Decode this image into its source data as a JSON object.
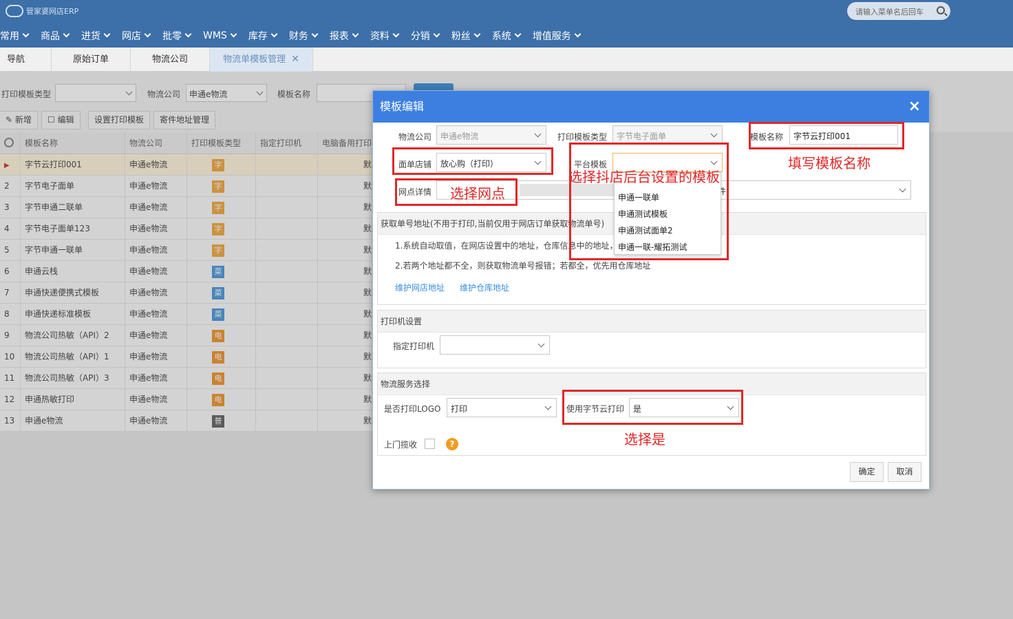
{
  "header": {
    "logo_text": "管家婆网店ERP",
    "search_placeholder": "请输入菜单名后回车"
  },
  "menu": [
    "常用",
    "商品",
    "进货",
    "网店",
    "批零",
    "WMS",
    "库存",
    "财务",
    "报表",
    "资料",
    "分销",
    "粉丝",
    "系统",
    "增值服务"
  ],
  "tabs": [
    {
      "label": "导航",
      "active": false
    },
    {
      "label": "原始订单",
      "active": false
    },
    {
      "label": "物流公司",
      "active": false
    },
    {
      "label": "物流单模板管理",
      "active": true
    }
  ],
  "filters": {
    "print_type_label": "打印模板类型",
    "print_type_value": "",
    "company_label": "物流公司",
    "company_value": "申通e物流",
    "name_label": "模板名称",
    "name_value": ""
  },
  "toolbar": {
    "add": "新增",
    "edit": "编辑",
    "set_print": "设置打印模板",
    "address": "寄件地址管理"
  },
  "grid": {
    "headers": [
      "模板名称",
      "物流公司",
      "打印模板类型",
      "指定打印机",
      "电脑备用打印"
    ],
    "rows": [
      {
        "no": "",
        "name": "字节云打印001",
        "company": "申通e物流",
        "badge": "字",
        "color": "#f0a030",
        "printer": "",
        "backup": "默"
      },
      {
        "no": "2",
        "name": "字节电子面单",
        "company": "申通e物流",
        "badge": "字",
        "color": "#f0a030",
        "printer": "",
        "backup": "默"
      },
      {
        "no": "3",
        "name": "字节申通二联单",
        "company": "申通e物流",
        "badge": "字",
        "color": "#f0a030",
        "printer": "",
        "backup": "默"
      },
      {
        "no": "4",
        "name": "字节电子面单123",
        "company": "申通e物流",
        "badge": "字",
        "color": "#f0a030",
        "printer": "",
        "backup": "默"
      },
      {
        "no": "5",
        "name": "字节申通一联单",
        "company": "申通e物流",
        "badge": "字",
        "color": "#f0a030",
        "printer": "",
        "backup": "默"
      },
      {
        "no": "6",
        "name": "申通云栈",
        "company": "申通e物流",
        "badge": "菜",
        "color": "#3a8ed8",
        "printer": "",
        "backup": "默"
      },
      {
        "no": "7",
        "name": "申通快递便携式模板",
        "company": "申通e物流",
        "badge": "菜",
        "color": "#3a8ed8",
        "printer": "",
        "backup": "默"
      },
      {
        "no": "8",
        "name": "申通快递标准模板",
        "company": "申通e物流",
        "badge": "菜",
        "color": "#3a8ed8",
        "printer": "",
        "backup": "默"
      },
      {
        "no": "9",
        "name": "物流公司热敏（API）2",
        "company": "申通e物流",
        "badge": "电",
        "color": "#ef8a1c",
        "printer": "",
        "backup": "默"
      },
      {
        "no": "10",
        "name": "物流公司热敏（API）1",
        "company": "申通e物流",
        "badge": "电",
        "color": "#ef8a1c",
        "printer": "",
        "backup": "默"
      },
      {
        "no": "11",
        "name": "物流公司热敏（API）3",
        "company": "申通e物流",
        "badge": "电",
        "color": "#ef8a1c",
        "printer": "",
        "backup": "默"
      },
      {
        "no": "12",
        "name": "申通热敏打印",
        "company": "申通e物流",
        "badge": "电",
        "color": "#ef8a1c",
        "printer": "",
        "backup": "默"
      },
      {
        "no": "13",
        "name": "申通e物流",
        "company": "申通e物流",
        "badge": "普",
        "color": "#555555",
        "printer": "",
        "backup": "默"
      }
    ]
  },
  "modal": {
    "title": "模板编辑",
    "company_label": "物流公司",
    "company_value": "申通e物流",
    "print_type_label": "打印模板类型",
    "print_type_value": "字节电子面单",
    "name_label": "模板名称",
    "name_value": "字节云打印001",
    "shop_label": "面单店铺",
    "shop_value": "放心购（打印）",
    "platform_label": "平台模板",
    "platform_value": "",
    "site_label": "网点详情",
    "site_tail": "件)",
    "platform_options": [
      "申通一联单",
      "申通测试模板",
      "申通测试面单2",
      "申通一联-耀拓测试"
    ],
    "address_section": "获取单号地址(不用于打印,当前仅用于网店订单获取物流单号)",
    "address_note1": "1.系统自动取值，在网店设置中的地址，仓库信息中的地址，",
    "address_note2": "2.若两个地址都不全，则获取物流单号报错；若都全，优先用仓库地址",
    "link_shop_address": "维护网店地址",
    "link_warehouse_address": "维护仓库地址",
    "printer_section": "打印机设置",
    "printer_label": "指定打印机",
    "printer_value": "",
    "service_section": "物流服务选择",
    "logo_label": "是否打印LOGO",
    "logo_value": "打印",
    "bytecloud_label": "使用字节云打印",
    "bytecloud_value": "是",
    "pickup_label": "上门揽收",
    "ok": "确定",
    "cancel": "取消"
  },
  "annotations": {
    "name": "填写模板名称",
    "site": "选择网点",
    "platform": "选择抖店后台设置的模板",
    "yes": "选择是"
  }
}
